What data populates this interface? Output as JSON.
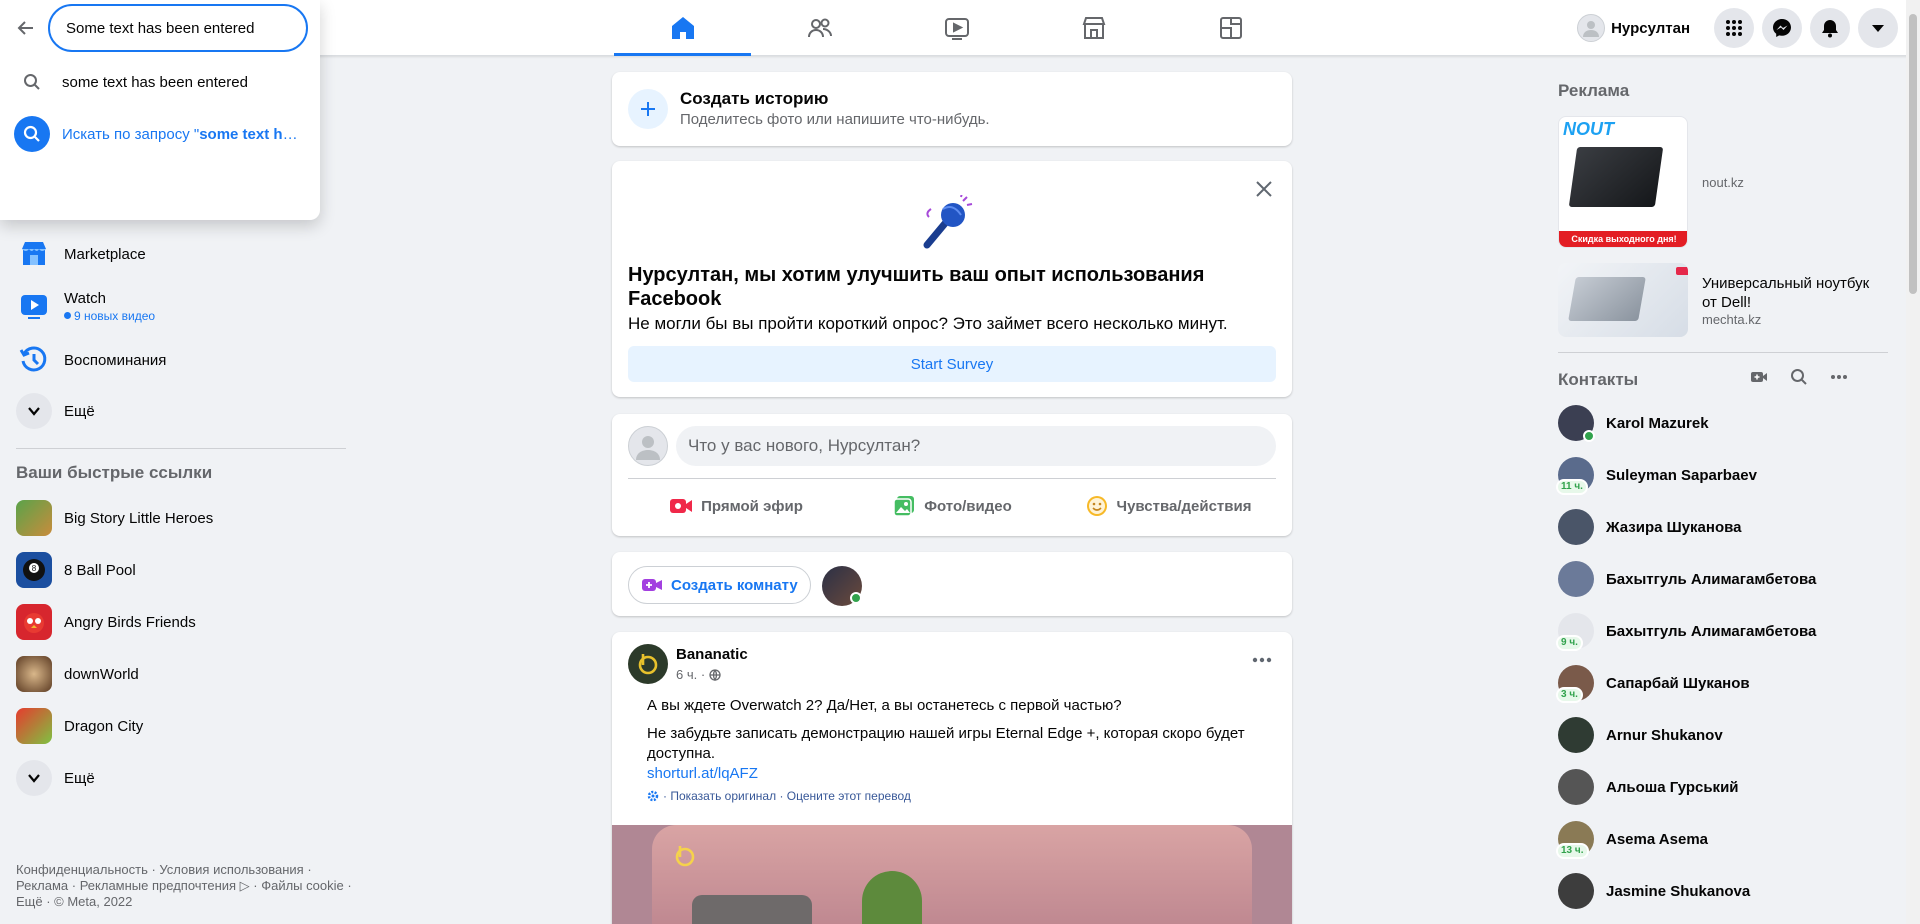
{
  "search": {
    "value": "Some text has been entered",
    "suggestion_text": "some text has been entered",
    "search_prefix": "Искать по запросу \"",
    "search_query": "some text ha..."
  },
  "header": {
    "profile_name": "Нурсултан",
    "tabs": [
      "home",
      "friends",
      "watch",
      "marketplace",
      "gaming"
    ]
  },
  "sidebar": {
    "items": [
      {
        "label": "Marketplace",
        "icon": "marketplace-icon"
      },
      {
        "label": "Watch",
        "icon": "watch-icon",
        "sub": "9 новых видео"
      },
      {
        "label": "Воспоминания",
        "icon": "memories-icon"
      },
      {
        "label": "Ещё",
        "icon": "chevron-down-icon"
      }
    ],
    "shortcuts_title": "Ваши быстрые ссылки",
    "shortcuts": [
      {
        "label": "Big Story Little Heroes"
      },
      {
        "label": "8 Ball Pool"
      },
      {
        "label": "Angry Birds Friends"
      },
      {
        "label": "downWorld"
      },
      {
        "label": "Dragon City"
      },
      {
        "label": "Ещё"
      }
    ],
    "footer": "Конфиденциальность · Условия использования · Реклама · Рекламные предпочтения ▷ · Файлы cookie · Ещё · © Meta, 2022"
  },
  "story": {
    "title": "Создать историю",
    "subtitle": "Поделитесь фото или напишите что-нибудь."
  },
  "survey": {
    "title": "Нурсултан, мы хотим улучшить ваш опыт использования Facebook",
    "subtitle": "Не могли бы вы пройти короткий опрос? Это займет всего несколько минут.",
    "button": "Start Survey"
  },
  "composer": {
    "placeholder": "Что у вас нового, Нурсултан?",
    "actions": [
      "Прямой эфир",
      "Фото/видео",
      "Чувства/действия"
    ]
  },
  "room": {
    "button": "Создать комнату"
  },
  "post": {
    "author": "Bananatic",
    "time": "6 ч. ·",
    "line1": "А вы ждете Overwatch 2? Да/Нет, а вы останетесь с первой частью?",
    "line2": "Не забудьте записать демонстрацию нашей игры Eternal Edge +, которая скоро будет доступна.",
    "link": "shorturl.at/lqAFZ",
    "translation": "· Показать оригинал · Оцените этот перевод"
  },
  "ads": {
    "title": "Реклама",
    "items": [
      {
        "text": "",
        "domain": "nout.kz",
        "img_label": "Скидка выходного дня!",
        "brand": "NOUT"
      },
      {
        "text": "Универсальный ноутбук от Dell!",
        "domain": "mechta.kz"
      }
    ]
  },
  "contacts": {
    "title": "Контакты",
    "list": [
      {
        "name": "Karol Mazurek",
        "online": true,
        "color": "#3b3f52"
      },
      {
        "name": "Suleyman Saparbaev",
        "badge": "11 ч.",
        "color": "#5a6b8c"
      },
      {
        "name": "Жазира Шуканова",
        "color": "#4a5568"
      },
      {
        "name": "Бахытгуль Алимагамбетова",
        "color": "#6b7a99"
      },
      {
        "name": "Бахытгуль Алимагамбетова",
        "badge": "9 ч.",
        "color": "#e4e6eb"
      },
      {
        "name": "Сапарбай Шуканов",
        "badge": "3 ч.",
        "color": "#7a5a4a"
      },
      {
        "name": "Arnur Shukanov",
        "color": "#2f3b33"
      },
      {
        "name": "Альоша Гурський",
        "color": "#555555"
      },
      {
        "name": "Asema Asema",
        "badge": "13 ч.",
        "color": "#8a7a55"
      },
      {
        "name": "Jasmine Shukanova",
        "color": "#3d3d3d"
      }
    ]
  }
}
